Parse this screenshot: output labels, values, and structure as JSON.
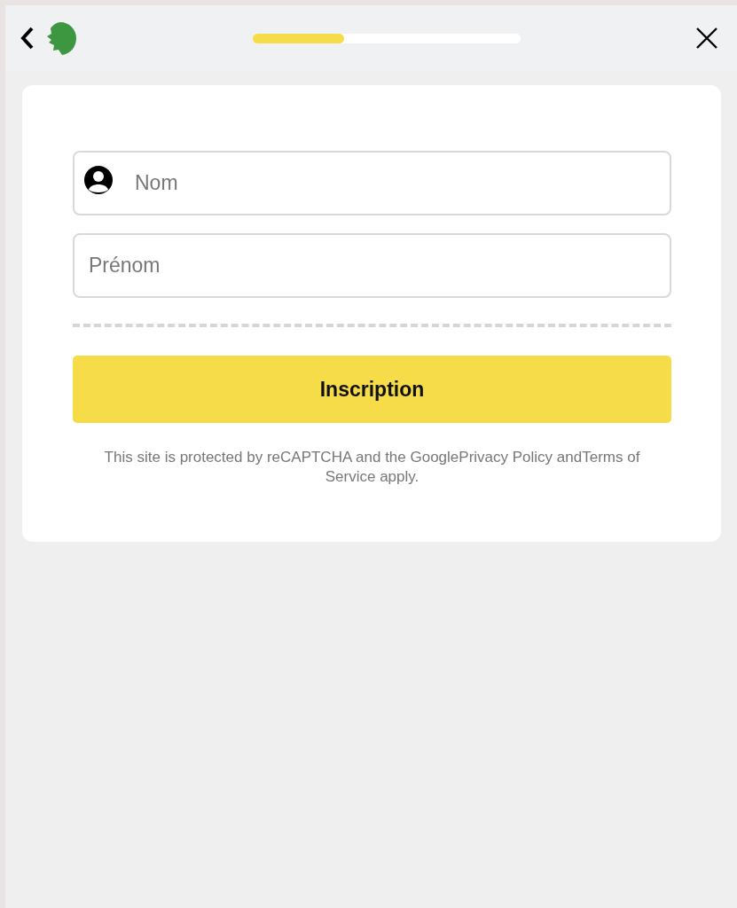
{
  "header": {
    "progress": {
      "level": 0.34
    }
  },
  "form": {
    "fields": [
      {
        "placeholder": "Nom",
        "kind": "icon"
      },
      {
        "placeholder": "Prénom",
        "kind": "plain"
      }
    ],
    "submit": "Inscription",
    "notice": "This site is protected by reCAPTCHA and the GooglePrivacy Policy andTerms of Service apply."
  }
}
